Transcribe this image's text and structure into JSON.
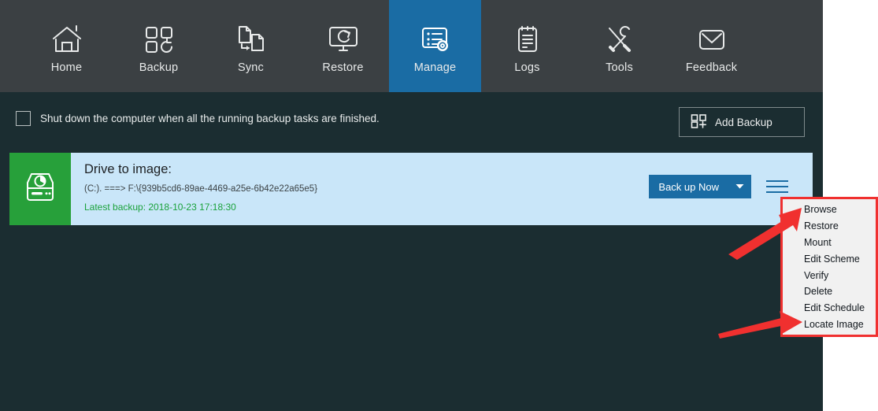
{
  "app": {
    "accent_blue": "#1a6ca4",
    "toolbar_bg": "#3b4043",
    "body_bg": "#1b2d31",
    "card_bg": "#c9e6f9",
    "card_icon_bg": "#27a03a",
    "annotation_red": "#f0302f"
  },
  "nav": {
    "items": [
      {
        "label": "Home",
        "icon": "home-icon",
        "active": false
      },
      {
        "label": "Backup",
        "icon": "backup-icon",
        "active": false
      },
      {
        "label": "Sync",
        "icon": "sync-icon",
        "active": false
      },
      {
        "label": "Restore",
        "icon": "restore-icon",
        "active": false
      },
      {
        "label": "Manage",
        "icon": "manage-icon",
        "active": true
      },
      {
        "label": "Logs",
        "icon": "logs-icon",
        "active": false
      },
      {
        "label": "Tools",
        "icon": "tools-icon",
        "active": false
      },
      {
        "label": "Feedback",
        "icon": "feedback-icon",
        "active": false
      }
    ]
  },
  "options": {
    "shutdown_label": "Shut down the computer when all the running backup tasks are finished.",
    "shutdown_checked": false,
    "add_backup_label": "Add Backup"
  },
  "task": {
    "title": "Drive to image:",
    "path": "(C:). ===> F:\\{939b5cd6-89ae-4469-a25e-6b42e22a65e5}",
    "latest_backup": "Latest backup: 2018-10-23 17:18:30",
    "backup_now_label": "Back up Now",
    "backup_now_caret": "▼"
  },
  "context_menu": {
    "items": [
      {
        "label": "Browse"
      },
      {
        "label": "Restore"
      },
      {
        "label": "Mount"
      },
      {
        "label": "Edit Scheme"
      },
      {
        "label": "Verify"
      },
      {
        "label": "Delete"
      },
      {
        "label": "Edit Schedule"
      },
      {
        "label": "Locate Image"
      }
    ]
  }
}
